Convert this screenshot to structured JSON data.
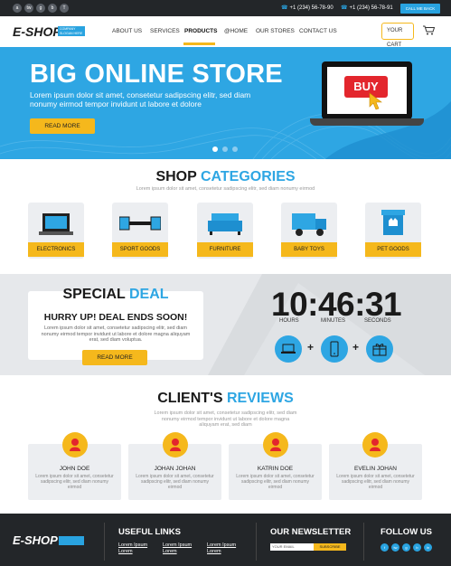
{
  "topbar": {
    "social": [
      "a",
      "tw",
      "g",
      "b",
      "T"
    ],
    "phone1": "+1 (234) 56-78-90",
    "phone2": "+1 (234) 56-78-91",
    "call_label": "CALL ME BACK"
  },
  "brand": {
    "logo": "E-SHOP",
    "tagline": "COMPANY SLOGAN HERE"
  },
  "nav": {
    "items": [
      "ABOUT US",
      "SERVICES",
      "PRODUCTS",
      "@HOME",
      "OUR STORES",
      "CONTACT US"
    ],
    "active": "PRODUCTS",
    "cart_label": "YOUR CART"
  },
  "hero": {
    "title": "BIG ONLINE STORE",
    "subtitle": "Lorem ipsum dolor sit amet, consetetur sadipscing elitr, sed diam nonumy eirmod tempor invidunt ut labore et dolore",
    "button": "READ MORE",
    "laptop_badge": "BUY"
  },
  "categories": {
    "title_plain": "SHOP",
    "title_accent": "CATEGORIES",
    "lorem": "Lorem ipsum dolor sit amet, consetetur sadipscing elitr, sed diam nonumy eirmod",
    "items": [
      "ELECTRONICS",
      "SPORT GOODS",
      "FURNITURE",
      "BABY TOYS",
      "PET GOODS"
    ]
  },
  "deal": {
    "title_plain": "SPECIAL",
    "title_accent": "DEAL",
    "headline": "HURRY UP! DEAL ENDS SOON!",
    "text": "Lorem ipsum dolor sit amet, consetetur sadipscing elitr, sed diam nonumy eirmod tempor invidunt ut labore et dolore magna aliquyam erat, sed diam voluptua.",
    "button": "READ MORE",
    "timer": "10:46:31",
    "labels": [
      "HOURS",
      "MINUTES",
      "SECONDS"
    ]
  },
  "reviews": {
    "title_plain": "CLIENT'S",
    "title_accent": "REVIEWS",
    "lorem": "Lorem ipsum dolor sit amet, consetetur sadipscing elitr, sed diam nonumy eirmod tempor invidunt ut labore et dolore magna aliquyam erat, sed diam",
    "items": [
      {
        "name": "JOHN DOE",
        "text": "Lorem ipsum dolor sit amet, consetetur sadipscing elitr, sed diam nonumy eirmod"
      },
      {
        "name": "JOHAN JOHAN",
        "text": "Lorem ipsum dolor sit amet, consetetur sadipscing elitr, sed diam nonumy eirmod"
      },
      {
        "name": "KATRIN DOE",
        "text": "Lorem ipsum dolor sit amet, consetetur sadipscing elitr, sed diam nonumy eirmod"
      },
      {
        "name": "EVELIN JOHAN",
        "text": "Lorem ipsum dolor sit amet, consetetur sadipscing elitr, sed diam nonumy eirmod"
      }
    ]
  },
  "footer": {
    "logo": "E-SHOP",
    "useful_links_title": "USEFUL LINKS",
    "links": [
      "Lorem Ipsum",
      "Lorem",
      "Lorem Ipsum",
      "Lorem",
      "Lorem Ipsum",
      "Lorem"
    ],
    "newsletter_title": "OUR NEWSLETTER",
    "email_placeholder": "YOUR EMAIL",
    "subscribe": "SUBSCRIBE",
    "follow_title": "FOLLOW US",
    "follow_icons": [
      "f",
      "tw",
      "g",
      "b",
      "in"
    ]
  },
  "colors": {
    "accent": "#2ea6e3",
    "yellow": "#f5b81c",
    "dark": "#232629"
  }
}
